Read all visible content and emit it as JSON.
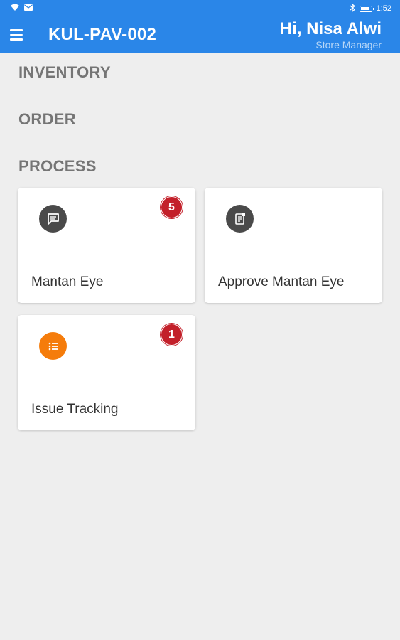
{
  "status_bar": {
    "time": "1:52",
    "icons": [
      "wifi-icon",
      "mail-icon",
      "bluetooth-icon",
      "battery-icon"
    ]
  },
  "header": {
    "store_code": "KUL-PAV-002",
    "greeting": "Hi, Nisa Alwi",
    "role": "Store Manager",
    "accent_color": "#2a86e8"
  },
  "sections": {
    "inventory": "INVENTORY",
    "order": "ORDER",
    "process": "PROCESS"
  },
  "process_cards": [
    {
      "label": "Mantan Eye",
      "badge": "5",
      "icon": "chat-icon",
      "icon_color": "#4a4a4a"
    },
    {
      "label": "Approve Mantan Eye",
      "badge": "",
      "icon": "document-icon",
      "icon_color": "#4a4a4a"
    },
    {
      "label": "Issue Tracking",
      "badge": "1",
      "icon": "list-icon",
      "icon_color": "#f57c0b"
    }
  ],
  "badge_color": "#c3202a"
}
